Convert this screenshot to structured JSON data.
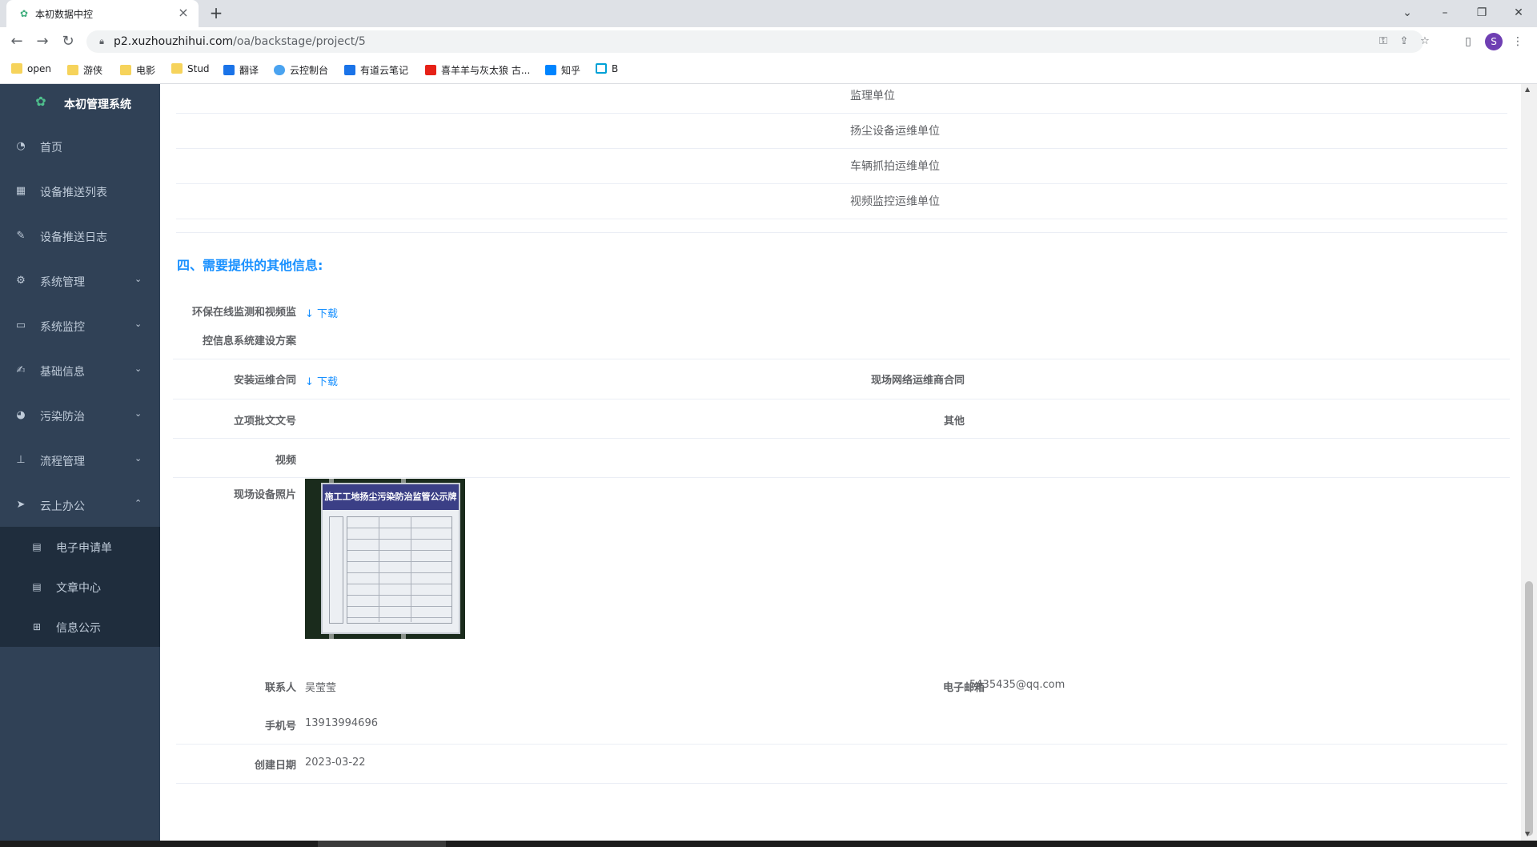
{
  "browser": {
    "tab_title": "本初数据中控",
    "url_host": "p2.xuzhouzhihui.com",
    "url_path": "/oa/backstage/project/5",
    "avatar_letter": "S",
    "bookmarks": [
      "open",
      "游侠",
      "电影",
      "Stud",
      "翻译",
      "云控制台",
      "有道云笔记",
      "喜羊羊与灰太狼 古...",
      "知乎",
      "B"
    ]
  },
  "sidebar": {
    "app_name": "本初管理系统",
    "items": [
      {
        "label": "首页",
        "icon": "dashboard-icon"
      },
      {
        "label": "设备推送列表",
        "icon": "table-icon"
      },
      {
        "label": "设备推送日志",
        "icon": "log-icon"
      },
      {
        "label": "系统管理",
        "icon": "gear-icon"
      },
      {
        "label": "系统监控",
        "icon": "monitor-icon"
      },
      {
        "label": "基础信息",
        "icon": "edit-icon"
      },
      {
        "label": "污染防治",
        "icon": "globe-icon"
      },
      {
        "label": "流程管理",
        "icon": "tree-icon"
      },
      {
        "label": "云上办公",
        "icon": "send-icon"
      }
    ],
    "submenu": [
      {
        "label": "电子申请单",
        "icon": "form-icon"
      },
      {
        "label": "文章中心",
        "icon": "document-icon"
      },
      {
        "label": "信息公示",
        "icon": "grid-icon"
      }
    ]
  },
  "units_table": {
    "rows": [
      "监理单位",
      "扬尘设备运维单位",
      "车辆抓拍运维单位",
      "视频监控运维单位"
    ]
  },
  "section": {
    "title": "四、需要提供的其他信息:"
  },
  "form": {
    "plan_label_line1": "环保在线监测和视频监",
    "plan_label_line2": "控信息系统建设方案",
    "download_label": "↓ 下载",
    "contract_label": "安装运维合同",
    "network_contract_label": "现场网络运维商合同",
    "approval_label": "立项批文文号",
    "other_label": "其他",
    "video_label": "视频",
    "photo_label": "现场设备照片",
    "photo_sign_title": "施工工地扬尘污染防治监管公示牌",
    "contact_label": "联系人",
    "contact_value": "吴莹莹",
    "email_label": "电子邮箱",
    "email_value": "5435435@qq.com",
    "phone_label": "手机号",
    "phone_value": "13913994696",
    "date_label": "创建日期",
    "date_value": "2023-03-22"
  }
}
